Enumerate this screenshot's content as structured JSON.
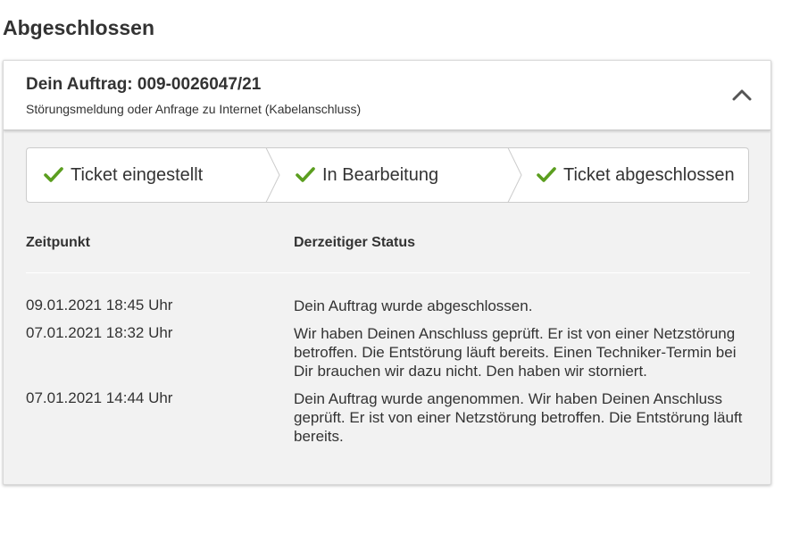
{
  "page": {
    "heading": "Abgeschlossen"
  },
  "order": {
    "title": "Dein Auftrag: 009-0026047/21",
    "subtitle": "Störungsmeldung oder Anfrage zu Internet (Kabelanschluss)",
    "toggle_icon": "chevron-up-icon"
  },
  "steps": [
    {
      "label": "Ticket eingestellt",
      "icon": "check-icon",
      "done": true
    },
    {
      "label": "In Bearbeitung",
      "icon": "check-icon",
      "done": true
    },
    {
      "label": "Ticket abgeschlossen",
      "icon": "check-icon",
      "done": true
    }
  ],
  "table": {
    "headers": {
      "time": "Zeitpunkt",
      "status": "Derzeitiger Status"
    },
    "rows": [
      {
        "time": "09.01.2021 18:45 Uhr",
        "status": "Dein Auftrag wurde abgeschlossen."
      },
      {
        "time": "07.01.2021 18:32 Uhr",
        "status": "Wir haben Deinen Anschluss geprüft. Er ist von einer Netzstörung betroffen. Die Entstörung läuft bereits. Einen Techniker-Termin bei Dir brauchen wir dazu nicht. Den haben wir storniert."
      },
      {
        "time": "07.01.2021 14:44 Uhr",
        "status": "Dein Auftrag wurde angenommen. Wir haben Deinen Anschluss geprüft. Er ist von einer Netzstörung betroffen. Die Entstörung läuft bereits."
      }
    ]
  },
  "colors": {
    "check": "#5b9e1f",
    "card_bg": "#f2f2f2",
    "text": "#333333"
  }
}
